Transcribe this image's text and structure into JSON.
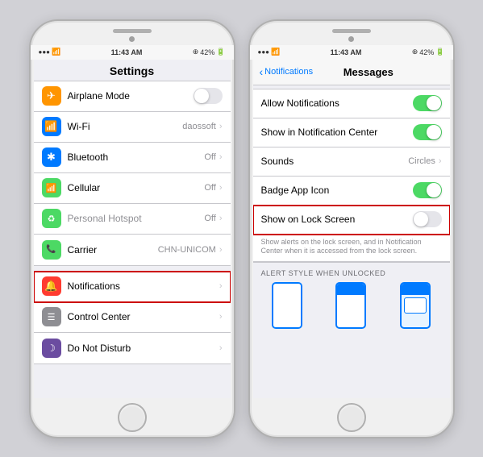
{
  "phone1": {
    "statusBar": {
      "signal": "●●●○○",
      "wifi": "wifi",
      "time": "11:43 AM",
      "location": "⊕",
      "battery": "42%"
    },
    "title": "Settings",
    "groups": [
      {
        "rows": [
          {
            "icon": "airplane",
            "iconBg": "#ff9500",
            "label": "Airplane Mode",
            "type": "toggle",
            "value": false
          },
          {
            "icon": "wifi",
            "iconBg": "#007aff",
            "label": "Wi-Fi",
            "type": "chevron",
            "value": "daossoft"
          },
          {
            "icon": "bluetooth",
            "iconBg": "#007aff",
            "label": "Bluetooth",
            "type": "chevron",
            "value": "Off"
          },
          {
            "icon": "cellular",
            "iconBg": "#4cd964",
            "label": "Cellular",
            "type": "chevron",
            "value": "Off"
          },
          {
            "icon": "hotspot",
            "iconBg": "#4cd964",
            "label": "Personal Hotspot",
            "type": "chevron",
            "value": "Off",
            "disabled": true
          },
          {
            "icon": "carrier",
            "iconBg": "#4cd964",
            "label": "Carrier",
            "type": "chevron",
            "value": "CHN-UNICOM"
          }
        ]
      },
      {
        "rows": [
          {
            "icon": "notifications",
            "iconBg": "#ff3b30",
            "label": "Notifications",
            "type": "chevron",
            "highlighted": true
          },
          {
            "icon": "controlcenter",
            "iconBg": "#8e8e93",
            "label": "Control Center",
            "type": "chevron"
          },
          {
            "icon": "donotdisturb",
            "iconBg": "#6b4ca0",
            "label": "Do Not Disturb",
            "type": "chevron"
          }
        ]
      }
    ]
  },
  "phone2": {
    "statusBar": {
      "time": "11:43 AM",
      "battery": "42%"
    },
    "navBack": "Notifications",
    "navTitle": "Messages",
    "rows": [
      {
        "label": "Allow Notifications",
        "type": "toggle",
        "value": true
      },
      {
        "label": "Show in Notification Center",
        "type": "toggle",
        "value": true
      },
      {
        "label": "Sounds",
        "type": "chevron",
        "value": "Circles"
      },
      {
        "label": "Badge App Icon",
        "type": "toggle",
        "value": true
      },
      {
        "label": "Show on Lock Screen",
        "type": "toggle",
        "value": false,
        "highlighted": true
      }
    ],
    "lockScreenNote": "Show alerts on the lock screen, and in Notification Center when it is accessed from the lock screen.",
    "alertSectionHeader": "ALERT STYLE WHEN UNLOCKED",
    "alertStyles": [
      "none",
      "banner",
      "alert"
    ]
  }
}
